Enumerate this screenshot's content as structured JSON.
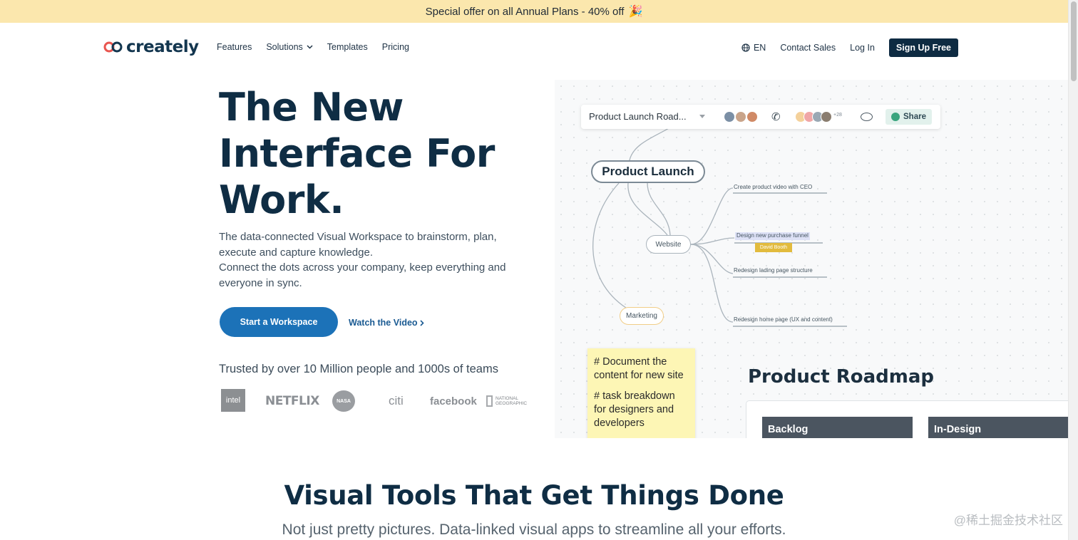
{
  "promo": {
    "text": "Special offer on all Annual Plans - 40% off",
    "icon": "party-popper-icon"
  },
  "nav": {
    "brand": "creately",
    "links": [
      "Features",
      "Solutions",
      "Templates",
      "Pricing"
    ],
    "language": "EN",
    "contact": "Contact Sales",
    "login": "Log In",
    "signup": "Sign Up Free"
  },
  "hero": {
    "title_lines": [
      "The New",
      "Interface For",
      "Work."
    ],
    "subtitle_lines": [
      "The data-connected Visual Workspace to brainstorm, plan,",
      "execute and capture knowledge.",
      "Connect the dots across your company, keep everything and",
      "everyone in sync."
    ],
    "cta": "Start a Workspace",
    "watch": "Watch the Video",
    "trusted": "Trusted by over 10 Million people and 1000s of teams",
    "brands": {
      "intel": "intel",
      "netflix": "NETFLIX",
      "nasa": "NASA",
      "citi": "citi",
      "facebook": "facebook",
      "natgeo_1": "NATIONAL",
      "natgeo_2": "GEOGRAPHIC"
    }
  },
  "mockup": {
    "doc_name": "Product Launch Road...",
    "extra_collaborators": "+28",
    "share": "Share",
    "mindmap": {
      "root": "Product Launch",
      "website": "Website",
      "marketing": "Marketing",
      "tasks": [
        "Create product video with CEO",
        "Design new purchase funnel",
        "Redesign lading page structure",
        "Redesign home page (UX and content)"
      ],
      "assignee": "David Booth"
    },
    "sticky_lines": [
      "# Document the",
      "content for new site",
      "# task breakdown",
      "for designers and",
      "developers"
    ],
    "roadmap_title": "Product Roadmap",
    "columns": [
      "Backlog",
      "In-Design"
    ]
  },
  "section": {
    "title": "Visual Tools That Get Things Done",
    "subtitle": "Not just pretty pictures. Data-linked visual apps to streamline all your efforts."
  },
  "watermark": "@稀土掘金技术社区",
  "colors": {
    "promo_bg": "#fbe7ad",
    "brand_dark": "#0f2d44",
    "cta_blue": "#1c72b8",
    "link_blue": "#1a5a92",
    "sticky": "#fdf6b5",
    "tag_yellow": "#e2bb3d",
    "share_green": "#3aa57e"
  }
}
